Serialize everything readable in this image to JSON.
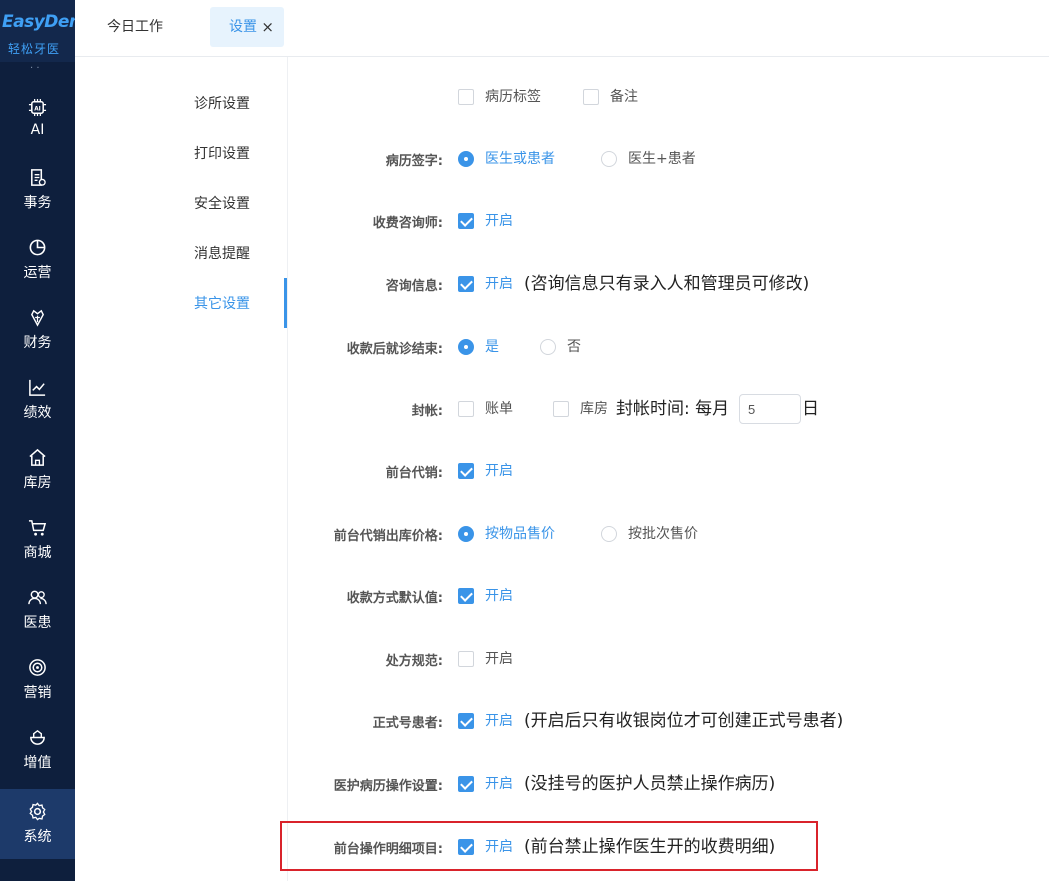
{
  "app": {
    "logo_text": "EasyDent",
    "logo_sub": "轻松牙医",
    "more_indicator": "· ·"
  },
  "nav": [
    {
      "label": "AI",
      "icon": "ai-chip-icon"
    },
    {
      "label": "事务",
      "icon": "document-icon"
    },
    {
      "label": "运营",
      "icon": "pie-chart-icon"
    },
    {
      "label": "财务",
      "icon": "finance-icon"
    },
    {
      "label": "绩效",
      "icon": "line-chart-icon"
    },
    {
      "label": "库房",
      "icon": "warehouse-icon"
    },
    {
      "label": "商城",
      "icon": "cart-icon"
    },
    {
      "label": "医患",
      "icon": "people-icon"
    },
    {
      "label": "营销",
      "icon": "target-icon"
    },
    {
      "label": "增值",
      "icon": "gift-icon"
    },
    {
      "label": "系统",
      "icon": "gear-icon",
      "active": true
    }
  ],
  "tabs": {
    "home": "今日工作",
    "settings": "设置",
    "close": "×"
  },
  "submenu": [
    "诊所设置",
    "打印设置",
    "安全设置",
    "消息提醒",
    "其它设置"
  ],
  "form": {
    "row0": {
      "opt1": "病历标签",
      "opt2": "备注"
    },
    "row1": {
      "label": "病历签字:",
      "opt1": "医生或患者",
      "opt2": "医生+患者"
    },
    "row2": {
      "label": "收费咨询师:",
      "opt1": "开启"
    },
    "row3": {
      "label": "咨询信息:",
      "opt1": "开启",
      "note": "(咨询信息只有录入人和管理员可修改)"
    },
    "row4": {
      "label": "收款后就诊结束:",
      "opt1": "是",
      "opt2": "否"
    },
    "row5": {
      "label": "封帐:",
      "opt1": "账单",
      "opt2": "库房",
      "note": "封帐时间:  每月",
      "day_value": "5",
      "day_unit": "日"
    },
    "row6": {
      "label": "前台代销:",
      "opt1": "开启"
    },
    "row7": {
      "label": "前台代销出库价格:",
      "opt1": "按物品售价",
      "opt2": "按批次售价"
    },
    "row8": {
      "label": "收款方式默认值:",
      "opt1": "开启"
    },
    "row9": {
      "label": "处方规范:",
      "opt1": "开启"
    },
    "row10": {
      "label": "正式号患者:",
      "opt1": "开启",
      "note": "(开启后只有收银岗位才可创建正式号患者)"
    },
    "row11": {
      "label": "医护病历操作设置:",
      "opt1": "开启",
      "note": "(没挂号的医护人员禁止操作病历)"
    },
    "row12": {
      "label": "前台操作明细项目:",
      "opt1": "开启",
      "note": "(前台禁止操作医生开的收费明细)"
    }
  },
  "colors": {
    "accent": "#3a94e8",
    "nav_bg": "#0e1f3d",
    "highlight": "#d9232b"
  }
}
